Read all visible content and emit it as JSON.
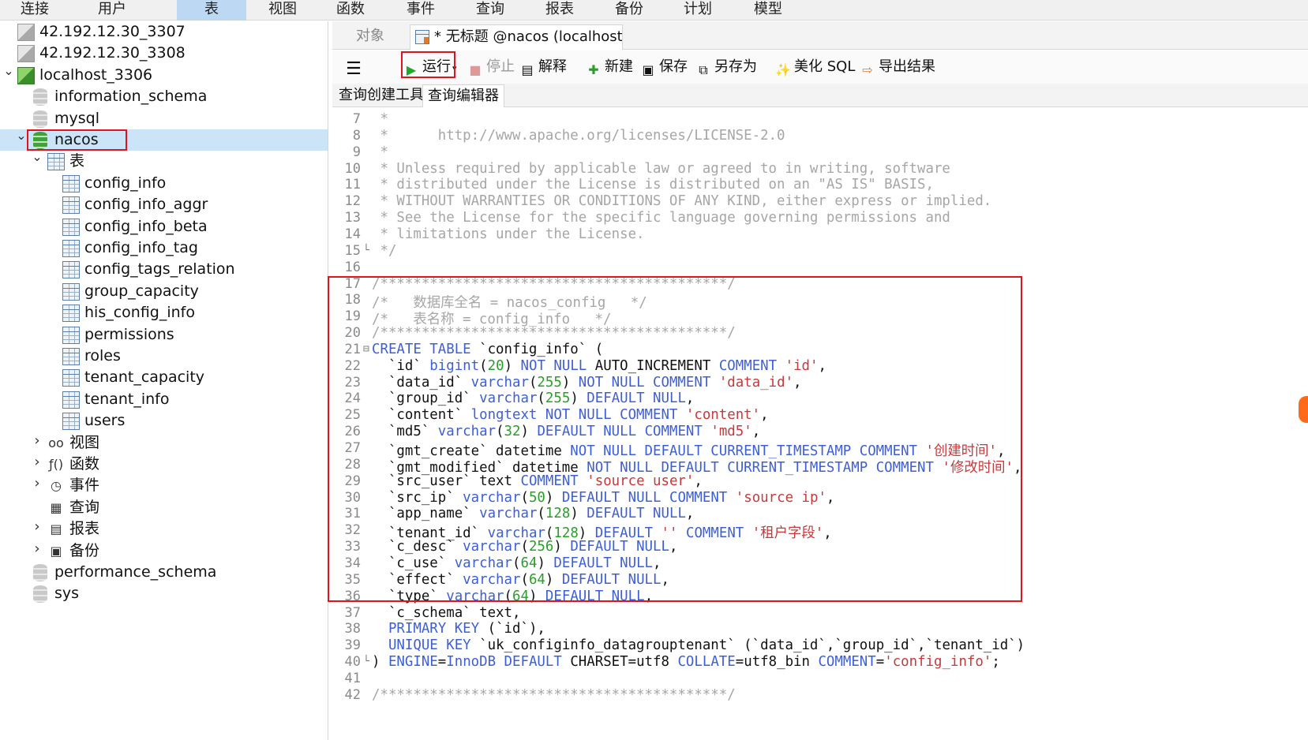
{
  "menu": {
    "items": [
      "连接",
      "用户",
      "表",
      "视图",
      "函数",
      "事件",
      "查询",
      "报表",
      "备份",
      "计划",
      "模型"
    ],
    "active_index": 2
  },
  "tree": {
    "connections": [
      "42.192.12.30_3307",
      "42.192.12.30_3308",
      "localhost_3306"
    ],
    "databases": [
      "information_schema",
      "mysql",
      "nacos",
      "performance_schema",
      "sys"
    ],
    "tables_node": "表",
    "tables": [
      "config_info",
      "config_info_aggr",
      "config_info_beta",
      "config_info_tag",
      "config_tags_relation",
      "group_capacity",
      "his_config_info",
      "permissions",
      "roles",
      "tenant_capacity",
      "tenant_info",
      "users"
    ],
    "object_nodes": [
      "视图",
      "函数",
      "事件",
      "查询",
      "报表",
      "备份"
    ],
    "selected": "nacos"
  },
  "tabs": {
    "objects": "对象",
    "query_tab": "* 无标题 @nacos (localhost_..."
  },
  "toolbar": {
    "run": "运行",
    "stop": "停止",
    "explain": "解释",
    "new": "新建",
    "save": "保存",
    "save_as": "另存为",
    "beautify": "美化 SQL",
    "export": "导出结果"
  },
  "subtabs": {
    "builder": "查询创建工具",
    "editor": "查询编辑器"
  },
  "editor": {
    "lines": [
      {
        "n": "7",
        "fold": "",
        "seg": [
          [
            "c",
            " *"
          ]
        ]
      },
      {
        "n": "8",
        "fold": "",
        "seg": [
          [
            "c",
            " *      http://www.apache.org/licenses/LICENSE-2.0"
          ]
        ]
      },
      {
        "n": "9",
        "fold": "",
        "seg": [
          [
            "c",
            " *"
          ]
        ]
      },
      {
        "n": "10",
        "fold": "",
        "seg": [
          [
            "c",
            " * Unless required by applicable law or agreed to in writing, software"
          ]
        ]
      },
      {
        "n": "11",
        "fold": "",
        "seg": [
          [
            "c",
            " * distributed under the License is distributed on an \"AS IS\" BASIS,"
          ]
        ]
      },
      {
        "n": "12",
        "fold": "",
        "seg": [
          [
            "c",
            " * WITHOUT WARRANTIES OR CONDITIONS OF ANY KIND, either express or implied."
          ]
        ]
      },
      {
        "n": "13",
        "fold": "",
        "seg": [
          [
            "c",
            " * See the License for the specific language governing permissions and"
          ]
        ]
      },
      {
        "n": "14",
        "fold": "",
        "seg": [
          [
            "c",
            " * limitations under the License."
          ]
        ]
      },
      {
        "n": "15",
        "fold": "└",
        "seg": [
          [
            "c",
            " */"
          ]
        ]
      },
      {
        "n": "16",
        "fold": "",
        "seg": []
      },
      {
        "n": "17",
        "fold": "",
        "seg": [
          [
            "c",
            "/******************************************/"
          ]
        ]
      },
      {
        "n": "18",
        "fold": "",
        "seg": [
          [
            "c",
            "/*   数据库全名 = nacos_config   */"
          ]
        ]
      },
      {
        "n": "19",
        "fold": "",
        "seg": [
          [
            "c",
            "/*   表名称 = config_info   */"
          ]
        ]
      },
      {
        "n": "20",
        "fold": "",
        "seg": [
          [
            "c",
            "/******************************************/"
          ]
        ]
      },
      {
        "n": "21",
        "fold": "⊟",
        "seg": [
          [
            "k",
            "CREATE TABLE"
          ],
          [
            "t",
            " `config_info` ("
          ]
        ]
      },
      {
        "n": "22",
        "fold": "",
        "seg": [
          [
            "t",
            "  `id` "
          ],
          [
            "k",
            "bigint"
          ],
          [
            "t",
            "("
          ],
          [
            "n",
            "20"
          ],
          [
            "t",
            ") "
          ],
          [
            "k",
            "NOT NULL"
          ],
          [
            "t",
            " AUTO_INCREMENT "
          ],
          [
            "k",
            "COMMENT"
          ],
          [
            "t",
            " "
          ],
          [
            "s",
            "'id'"
          ],
          [
            "t",
            ","
          ]
        ]
      },
      {
        "n": "23",
        "fold": "",
        "seg": [
          [
            "t",
            "  `data_id` "
          ],
          [
            "k",
            "varchar"
          ],
          [
            "t",
            "("
          ],
          [
            "n",
            "255"
          ],
          [
            "t",
            ") "
          ],
          [
            "k",
            "NOT NULL COMMENT"
          ],
          [
            "t",
            " "
          ],
          [
            "s",
            "'data_id'"
          ],
          [
            "t",
            ","
          ]
        ]
      },
      {
        "n": "24",
        "fold": "",
        "seg": [
          [
            "t",
            "  `group_id` "
          ],
          [
            "k",
            "varchar"
          ],
          [
            "t",
            "("
          ],
          [
            "n",
            "255"
          ],
          [
            "t",
            ") "
          ],
          [
            "k",
            "DEFAULT NULL"
          ],
          [
            "t",
            ","
          ]
        ]
      },
      {
        "n": "25",
        "fold": "",
        "seg": [
          [
            "t",
            "  `content` "
          ],
          [
            "k",
            "longtext NOT NULL COMMENT"
          ],
          [
            "t",
            " "
          ],
          [
            "s",
            "'content'"
          ],
          [
            "t",
            ","
          ]
        ]
      },
      {
        "n": "26",
        "fold": "",
        "seg": [
          [
            "t",
            "  `md5` "
          ],
          [
            "k",
            "varchar"
          ],
          [
            "t",
            "("
          ],
          [
            "n",
            "32"
          ],
          [
            "t",
            ") "
          ],
          [
            "k",
            "DEFAULT NULL COMMENT"
          ],
          [
            "t",
            " "
          ],
          [
            "s",
            "'md5'"
          ],
          [
            "t",
            ","
          ]
        ]
      },
      {
        "n": "27",
        "fold": "",
        "seg": [
          [
            "t",
            "  `gmt_create` datetime "
          ],
          [
            "k",
            "NOT NULL DEFAULT CURRENT_TIMESTAMP COMMENT"
          ],
          [
            "t",
            " "
          ],
          [
            "s",
            "'创建时间'"
          ],
          [
            "t",
            ","
          ]
        ]
      },
      {
        "n": "28",
        "fold": "",
        "seg": [
          [
            "t",
            "  `gmt_modified` datetime "
          ],
          [
            "k",
            "NOT NULL DEFAULT CURRENT_TIMESTAMP COMMENT"
          ],
          [
            "t",
            " "
          ],
          [
            "s",
            "'修改时间'"
          ],
          [
            "t",
            ","
          ]
        ]
      },
      {
        "n": "29",
        "fold": "",
        "seg": [
          [
            "t",
            "  `src_user` text "
          ],
          [
            "k",
            "COMMENT"
          ],
          [
            "t",
            " "
          ],
          [
            "s",
            "'source user'"
          ],
          [
            "t",
            ","
          ]
        ]
      },
      {
        "n": "30",
        "fold": "",
        "seg": [
          [
            "t",
            "  `src_ip` "
          ],
          [
            "k",
            "varchar"
          ],
          [
            "t",
            "("
          ],
          [
            "n",
            "50"
          ],
          [
            "t",
            ") "
          ],
          [
            "k",
            "DEFAULT NULL COMMENT"
          ],
          [
            "t",
            " "
          ],
          [
            "s",
            "'source ip'"
          ],
          [
            "t",
            ","
          ]
        ]
      },
      {
        "n": "31",
        "fold": "",
        "seg": [
          [
            "t",
            "  `app_name` "
          ],
          [
            "k",
            "varchar"
          ],
          [
            "t",
            "("
          ],
          [
            "n",
            "128"
          ],
          [
            "t",
            ") "
          ],
          [
            "k",
            "DEFAULT NULL"
          ],
          [
            "t",
            ","
          ]
        ]
      },
      {
        "n": "32",
        "fold": "",
        "seg": [
          [
            "t",
            "  `tenant_id` "
          ],
          [
            "k",
            "varchar"
          ],
          [
            "t",
            "("
          ],
          [
            "n",
            "128"
          ],
          [
            "t",
            ") "
          ],
          [
            "k",
            "DEFAULT"
          ],
          [
            "t",
            " "
          ],
          [
            "s",
            "''"
          ],
          [
            "t",
            " "
          ],
          [
            "k",
            "COMMENT"
          ],
          [
            "t",
            " "
          ],
          [
            "s",
            "'租户字段'"
          ],
          [
            "t",
            ","
          ]
        ]
      },
      {
        "n": "33",
        "fold": "",
        "seg": [
          [
            "t",
            "  `c_desc` "
          ],
          [
            "k",
            "varchar"
          ],
          [
            "t",
            "("
          ],
          [
            "n",
            "256"
          ],
          [
            "t",
            ") "
          ],
          [
            "k",
            "DEFAULT NULL"
          ],
          [
            "t",
            ","
          ]
        ]
      },
      {
        "n": "34",
        "fold": "",
        "seg": [
          [
            "t",
            "  `c_use` "
          ],
          [
            "k",
            "varchar"
          ],
          [
            "t",
            "("
          ],
          [
            "n",
            "64"
          ],
          [
            "t",
            ") "
          ],
          [
            "k",
            "DEFAULT NULL"
          ],
          [
            "t",
            ","
          ]
        ]
      },
      {
        "n": "35",
        "fold": "",
        "seg": [
          [
            "t",
            "  `effect` "
          ],
          [
            "k",
            "varchar"
          ],
          [
            "t",
            "("
          ],
          [
            "n",
            "64"
          ],
          [
            "t",
            ") "
          ],
          [
            "k",
            "DEFAULT NULL"
          ],
          [
            "t",
            ","
          ]
        ]
      },
      {
        "n": "36",
        "fold": "",
        "seg": [
          [
            "t",
            "  `type` "
          ],
          [
            "k",
            "varchar"
          ],
          [
            "t",
            "("
          ],
          [
            "n",
            "64"
          ],
          [
            "t",
            ") "
          ],
          [
            "k",
            "DEFAULT NULL"
          ],
          [
            "t",
            ","
          ]
        ]
      },
      {
        "n": "37",
        "fold": "",
        "seg": [
          [
            "t",
            "  `c_schema` text,"
          ]
        ]
      },
      {
        "n": "38",
        "fold": "",
        "seg": [
          [
            "t",
            "  "
          ],
          [
            "k",
            "PRIMARY KEY"
          ],
          [
            "t",
            " (`id`),"
          ]
        ]
      },
      {
        "n": "39",
        "fold": "",
        "seg": [
          [
            "t",
            "  "
          ],
          [
            "k",
            "UNIQUE KEY"
          ],
          [
            "t",
            " `uk_configinfo_datagrouptenant` (`data_id`,`group_id`,`tenant_id`)"
          ]
        ]
      },
      {
        "n": "40",
        "fold": "└",
        "seg": [
          [
            "t",
            ") "
          ],
          [
            "k",
            "ENGINE"
          ],
          [
            "t",
            "="
          ],
          [
            "k",
            "InnoDB DEFAULT"
          ],
          [
            "t",
            " CHARSET=utf8 "
          ],
          [
            "k",
            "COLLATE"
          ],
          [
            "t",
            "=utf8_bin "
          ],
          [
            "k",
            "COMMENT"
          ],
          [
            "t",
            "="
          ],
          [
            "s",
            "'config_info'"
          ],
          [
            "t",
            ";"
          ]
        ]
      },
      {
        "n": "41",
        "fold": "",
        "seg": []
      },
      {
        "n": "42",
        "fold": "",
        "seg": [
          [
            "c",
            "/******************************************/"
          ]
        ]
      }
    ]
  },
  "colors": {
    "keyword": "#3c5fd6",
    "number": "#2a9d2a",
    "string": "#c53a3a",
    "comment": "#a6a6a6",
    "highlight": "#e0141e",
    "selection": "#cce4f7"
  }
}
